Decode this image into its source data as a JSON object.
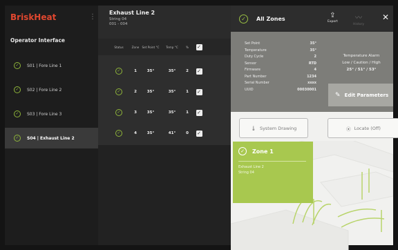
{
  "sidebar": {
    "brand": "BriskHeat",
    "menu_icon": "kebab-menu-icon",
    "subtitle": "Operator Interface",
    "items": [
      {
        "label": "S01 | Fore Line 1",
        "icon": "check-circle-icon"
      },
      {
        "label": "S02 | Fore Line 2",
        "icon": "check-circle-icon"
      },
      {
        "label": "S03 | Fore Line 3",
        "icon": "check-circle-icon"
      },
      {
        "label": "S04 | Exhaust Line 2",
        "icon": "check-circle-icon",
        "active": true
      }
    ]
  },
  "middle": {
    "title": "Exhaust Line 2",
    "line2": "String 04",
    "line3": "001 - 004",
    "columns": {
      "status": "Status",
      "zone": "Zone",
      "setpoint": "Set Point °C",
      "temp": "Temp °C",
      "percent": "%"
    },
    "rows": [
      {
        "zone": "1",
        "setpoint": "35°",
        "temp": "35°",
        "percent": "2"
      },
      {
        "zone": "2",
        "setpoint": "35°",
        "temp": "35°",
        "percent": "1"
      },
      {
        "zone": "3",
        "setpoint": "35°",
        "temp": "35°",
        "percent": "1"
      },
      {
        "zone": "4",
        "setpoint": "35°",
        "temp": "41°",
        "percent": "0"
      }
    ]
  },
  "right": {
    "title": "All Zones",
    "export_label": "Export",
    "history_label": "History",
    "close_icon": "close-icon",
    "details": [
      {
        "key": "Set Point",
        "value": "35°"
      },
      {
        "key": "Temperature",
        "value": "35°"
      },
      {
        "key": "Duty Cycle",
        "value": "2"
      },
      {
        "key": "Sensor",
        "value": "RTD"
      },
      {
        "key": "Firmware",
        "value": "4"
      },
      {
        "key": "Part Number",
        "value": "1234"
      },
      {
        "key": "Serial Number",
        "value": "xxxx"
      },
      {
        "key": "UUID",
        "value": "00030001"
      }
    ],
    "alarm": {
      "title": "Temperature Alarm",
      "levels": "Low / Caution / High",
      "values": "25° / 51° / 53°"
    },
    "edit_button": "Edit Parameters",
    "system_drawing_button": "System Drawing",
    "locate_button": "Locate (Off)",
    "zone_card": {
      "title": "Zone 1",
      "line1": "Exhaust Line 2",
      "line2": "String 04"
    }
  },
  "colors": {
    "brand": "#e0472f",
    "ok_green": "#8fb53a",
    "zone_card": "#a8c84f"
  }
}
